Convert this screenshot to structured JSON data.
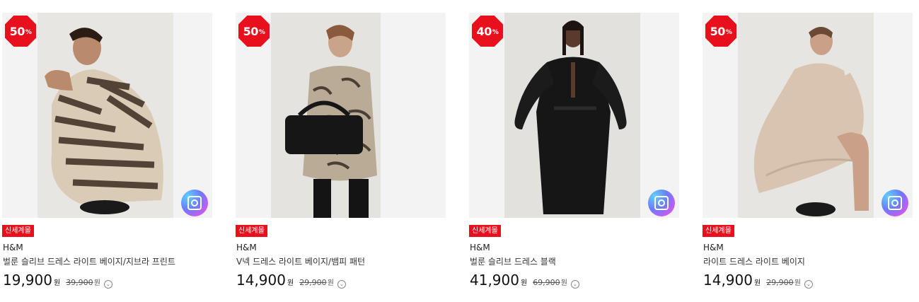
{
  "products": [
    {
      "discount": "50",
      "discount_unit": "%",
      "tag": "신세계몰",
      "brand": "H&M",
      "name": "벌룬 슬리브 드레스 라이트 베이지/지브라 프린트",
      "price": "19,900",
      "price_unit": "원",
      "original_price": "39,900",
      "original_unit": "원",
      "has_image_search": true
    },
    {
      "discount": "50",
      "discount_unit": "%",
      "tag": "신세계몰",
      "brand": "H&M",
      "name": "V넥 드레스 라이트 베이지/뱀피 패턴",
      "price": "14,900",
      "price_unit": "원",
      "original_price": "29,900",
      "original_unit": "원",
      "has_image_search": false
    },
    {
      "discount": "40",
      "discount_unit": "%",
      "tag": "신세계몰",
      "brand": "H&M",
      "name": "벌룬 슬리브 드레스 블랙",
      "price": "41,900",
      "price_unit": "원",
      "original_price": "69,900",
      "original_unit": "원",
      "has_image_search": true
    },
    {
      "discount": "50",
      "discount_unit": "%",
      "tag": "신세계몰",
      "brand": "H&M",
      "name": "라이트 드레스 라이트 베이지",
      "price": "14,900",
      "price_unit": "원",
      "original_price": "29,900",
      "original_unit": "원",
      "has_image_search": true
    }
  ],
  "icons": {
    "image_search": "camera-search-icon",
    "info": "info-circle-icon"
  },
  "colors": {
    "badge": "#e8101c",
    "tag": "#e8101c"
  }
}
